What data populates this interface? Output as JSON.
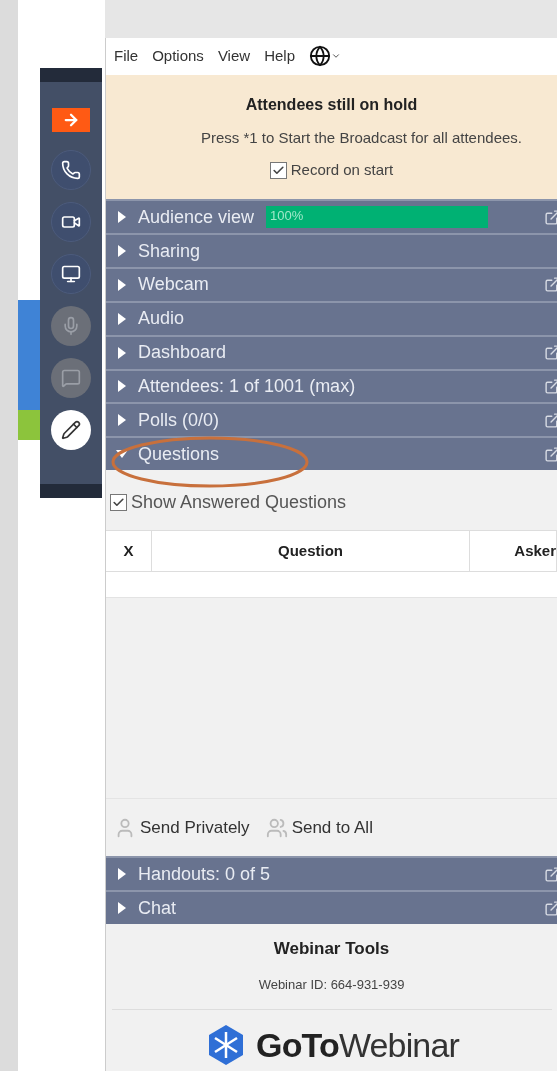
{
  "menu": [
    "File",
    "Options",
    "View",
    "Help"
  ],
  "banner": {
    "title": "Attendees still on hold",
    "message": "Press *1 to Start the Broadcast for all attendees.",
    "record": {
      "label": "Record on start",
      "checked": true
    }
  },
  "toolbar": [
    {
      "kind": "arrow",
      "disabled": false
    },
    {
      "kind": "phone",
      "disabled": false
    },
    {
      "kind": "camera",
      "disabled": false
    },
    {
      "kind": "screen",
      "disabled": false
    },
    {
      "kind": "mic",
      "disabled": true
    },
    {
      "kind": "chat",
      "disabled": true
    },
    {
      "kind": "pen",
      "disabled": false
    }
  ],
  "sections": [
    {
      "label": "Audience view",
      "expanded": false,
      "popout": true,
      "meter": {
        "reading": "100%",
        "level": 1.0
      }
    },
    {
      "label": "Sharing",
      "expanded": false,
      "popout": false
    },
    {
      "label": "Webcam",
      "expanded": false,
      "popout": true
    },
    {
      "label": "Audio",
      "expanded": false,
      "popout": false
    },
    {
      "label": "Dashboard",
      "expanded": false,
      "popout": true
    },
    {
      "label": "Attendees: 1 of 1001 (max)",
      "expanded": false,
      "popout": true
    },
    {
      "label": "Polls (0/0)",
      "expanded": false,
      "popout": true
    },
    {
      "label": "Questions",
      "expanded": true,
      "popout": true
    }
  ],
  "questions": {
    "show_answered": {
      "label": "Show Answered Questions",
      "checked": true
    },
    "columns": [
      "X",
      "Question",
      "Asker"
    ],
    "send_buttons": [
      {
        "kind": "private",
        "label": "Send Privately"
      },
      {
        "kind": "all",
        "label": "Send to All"
      }
    ]
  },
  "lower_sections": [
    {
      "label": "Handouts: 0 of 5",
      "expanded": false,
      "popout": true
    },
    {
      "label": "Chat",
      "expanded": false,
      "popout": true
    }
  ],
  "footer": {
    "title": "Webinar Tools",
    "webinar_id": "Webinar ID: 664-931-939",
    "logo": {
      "bold": "GoTo",
      "light": "Webinar"
    }
  }
}
